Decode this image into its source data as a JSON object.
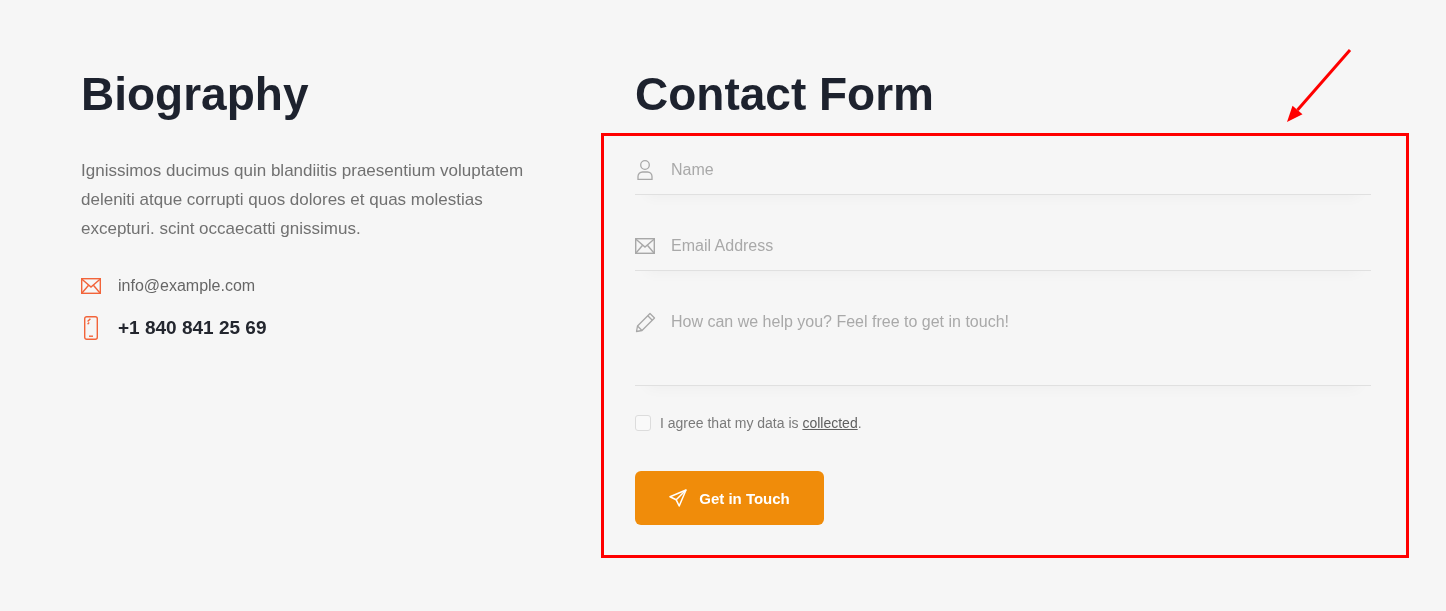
{
  "biography": {
    "title": "Biography",
    "text": "Ignissimos ducimus quin blandiitis praesentium voluptatem deleniti atque corrupti quos dolores et quas molestias excepturi. scint occaecatti gnissimus.",
    "contacts": [
      {
        "kind": "email",
        "text": "info@example.com"
      },
      {
        "kind": "phone",
        "text": "+1 840 841 25 69"
      }
    ]
  },
  "contact_form": {
    "title": "Contact Form",
    "fields": [
      {
        "kind": "name",
        "placeholder": "Name"
      },
      {
        "kind": "email",
        "placeholder": "Email Address"
      },
      {
        "kind": "message",
        "placeholder": "How can we help you? Feel free to get in touch!"
      }
    ],
    "consent": {
      "text": "I agree that my data is",
      "link": "collected",
      "text_after": ".",
      "checked": false
    },
    "submit_button": {
      "label": "Get in Touch"
    }
  },
  "highlight": {
    "kind": "frame_with_arrow"
  }
}
